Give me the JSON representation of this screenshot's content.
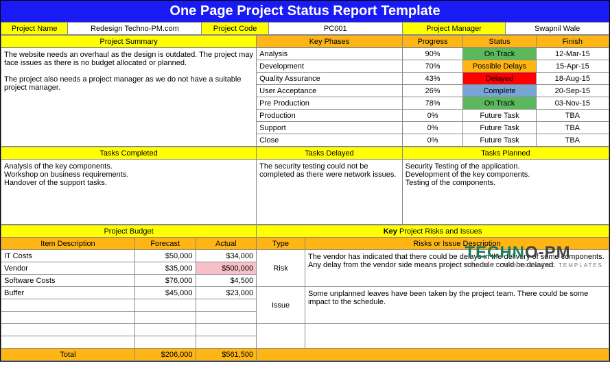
{
  "title": "One Page Project Status Report Template",
  "info": {
    "project_name_label": "Project Name",
    "project_name": "Redesign Techno-PM.com",
    "project_code_label": "Project Code",
    "project_code": "PC001",
    "project_manager_label": "Project Manager",
    "project_manager": "Swapnil Wale"
  },
  "summary": {
    "header": "Project Summary",
    "text_p1": "The website needs an overhaul as the design is outdated. The project may face issues as there is no budget allocated or planned.",
    "text_p2": "The project also needs a project manager as we do not have a suitable project manager."
  },
  "phases": {
    "header": "Key Phases",
    "progress_h": "Progress",
    "status_h": "Status",
    "finish_h": "Finish",
    "rows": [
      {
        "name": "Analysis",
        "progress": "90%",
        "status": "On Track",
        "status_cls": "status-ontrack",
        "finish": "12-Mar-15"
      },
      {
        "name": "Development",
        "progress": "70%",
        "status": "Possible Delays",
        "status_cls": "status-possible",
        "finish": "15-Apr-15"
      },
      {
        "name": "Quality Assurance",
        "progress": "43%",
        "status": "Delayed",
        "status_cls": "status-delayed",
        "finish": "18-Aug-15"
      },
      {
        "name": "User Acceptance",
        "progress": "26%",
        "status": "Complete",
        "status_cls": "status-complete",
        "finish": "20-Sep-15"
      },
      {
        "name": "Pre Production",
        "progress": "78%",
        "status": "On Track",
        "status_cls": "status-ontrack",
        "finish": "03-Nov-15"
      },
      {
        "name": "Production",
        "progress": "0%",
        "status": "Future Task",
        "status_cls": "center",
        "finish": "TBA"
      },
      {
        "name": "Support",
        "progress": "0%",
        "status": "Future Task",
        "status_cls": "center",
        "finish": "TBA"
      },
      {
        "name": "Close",
        "progress": "0%",
        "status": "Future Task",
        "status_cls": "center",
        "finish": "TBA"
      }
    ]
  },
  "tasks": {
    "completed_h": "Tasks Completed",
    "delayed_h": "Tasks Delayed",
    "planned_h": "Tasks Planned",
    "completed": "Analysis of the key components.\nWorkshop on business requirements.\nHandover of the support tasks.",
    "delayed": "The security testing could not be completed as there were network issues.",
    "planned": "Security Testing of the application.\nDevelopment of the key components.\nTesting of the components."
  },
  "budget": {
    "header": "Project Budget",
    "item_h": "Item Description",
    "forecast_h": "Forecast",
    "actual_h": "Actual",
    "rows": [
      {
        "item": "IT Costs",
        "forecast": "$50,000",
        "actual": "$34,000",
        "actual_cls": ""
      },
      {
        "item": "Vendor",
        "forecast": "$35,000",
        "actual": "$500,000",
        "actual_cls": "highlight-red"
      },
      {
        "item": "Software Costs",
        "forecast": "$76,000",
        "actual": "$4,500",
        "actual_cls": ""
      },
      {
        "item": "Buffer",
        "forecast": "$45,000",
        "actual": "$23,000",
        "actual_cls": ""
      }
    ],
    "total_label": "Total",
    "total_forecast": "$206,000",
    "total_actual": "$561,500"
  },
  "risks": {
    "header": "Key Project Risks and Issues",
    "type_h": "Type",
    "desc_h": "Risks or Issue Description",
    "rows": [
      {
        "type": "Risk",
        "desc": "The vendor has indicated that there could be delays in the delivery of some components. Any delay from the vendor side means project schedule could be delayed."
      },
      {
        "type": "Issue",
        "desc": "Some unplanned leaves have been taken by the project team. There could be some impact to the schedule."
      }
    ]
  },
  "watermark": {
    "brand1": "TECHN",
    "brand2": "O-PM",
    "sub": "PROJECT MANAGEMENT TEMPLATES"
  }
}
